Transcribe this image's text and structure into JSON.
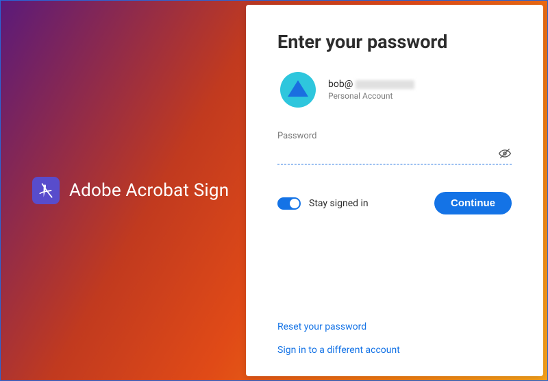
{
  "brand": {
    "title": "Adobe Acrobat Sign"
  },
  "login": {
    "heading": "Enter your password",
    "account": {
      "email_visible": "bob@",
      "type_label": "Personal Account"
    },
    "password": {
      "label": "Password",
      "value": ""
    },
    "stay_signed_in": {
      "label": "Stay signed in",
      "checked": true
    },
    "continue_label": "Continue",
    "links": {
      "reset": "Reset your password",
      "different": "Sign in to a different account"
    }
  }
}
